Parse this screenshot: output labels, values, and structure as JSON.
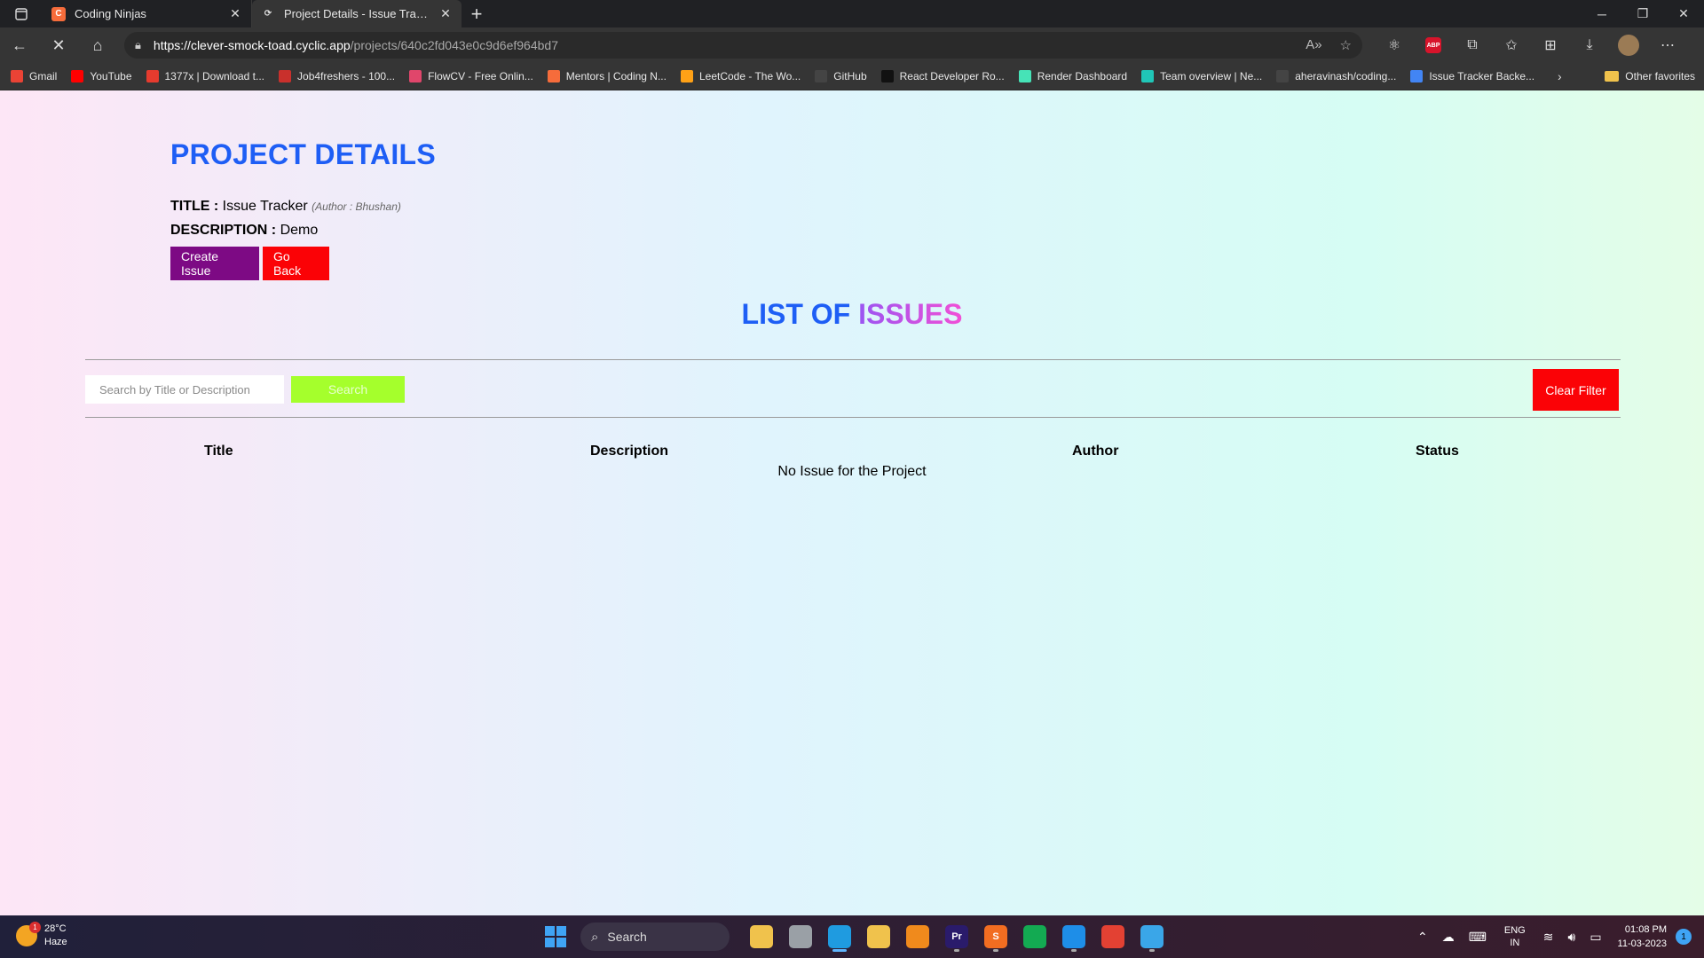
{
  "browser": {
    "tabs": [
      {
        "title": "Coding Ninjas",
        "favicon": "coding-ninjas-icon",
        "favicon_color": "#f66c3b"
      },
      {
        "title": "Project Details - Issue Tracker App",
        "favicon": "loading-icon",
        "favicon_color": "#353535"
      }
    ],
    "url": {
      "host": "https://clever-smock-toad.cyclic.app",
      "path": "/projects/640c2fd043e0c9d6ef964bd7"
    },
    "bookmarks": [
      {
        "label": "Gmail",
        "icon": "gmail-icon",
        "color": "#ea4335"
      },
      {
        "label": "YouTube",
        "icon": "youtube-icon",
        "color": "#ff0000"
      },
      {
        "label": "1377x | Download t...",
        "icon": "1377x-icon",
        "color": "#e63b2e"
      },
      {
        "label": "Job4freshers - 100...",
        "icon": "job4freshers-icon",
        "color": "#c9302c"
      },
      {
        "label": "FlowCV - Free Onlin...",
        "icon": "flowcv-icon",
        "color": "#e0466b"
      },
      {
        "label": "Mentors | Coding N...",
        "icon": "coding-ninjas-icon",
        "color": "#f66c3b"
      },
      {
        "label": "LeetCode - The Wo...",
        "icon": "leetcode-icon",
        "color": "#ffa116"
      },
      {
        "label": "GitHub",
        "icon": "github-icon",
        "color": "#444444"
      },
      {
        "label": "React Developer Ro...",
        "icon": "roadmap-icon",
        "color": "#111111"
      },
      {
        "label": "Render Dashboard",
        "icon": "render-icon",
        "color": "#46e3b7"
      },
      {
        "label": "Team overview | Ne...",
        "icon": "netlify-icon",
        "color": "#20c6b7"
      },
      {
        "label": "aheravinash/coding...",
        "icon": "github-icon",
        "color": "#444444"
      },
      {
        "label": "Issue Tracker Backe...",
        "icon": "docs-icon",
        "color": "#4285f4"
      }
    ],
    "other_favorites": "Other favorites"
  },
  "page": {
    "heading": "PROJECT DETAILS",
    "title_label": "TITLE :",
    "title_value": "Issue Tracker",
    "author_text": "(Author : Bhushan)",
    "description_label": "DESCRIPTION :",
    "description_value": "Demo",
    "create_button": "Create Issue",
    "back_button": "Go Back",
    "list_heading_part1": "LIST OF",
    "list_heading_part2": "ISSUES",
    "search_placeholder": "Search by Title or Description",
    "search_button": "Search",
    "clear_button": "Clear Filter",
    "columns": [
      "Title",
      "Description",
      "Author",
      "Status"
    ],
    "empty_message": "No Issue for the Project",
    "colors": {
      "heading_blue": "#1e5ef5",
      "create_purple": "#7d0a84",
      "danger_red": "#fb0206",
      "search_green": "#a5ff2c"
    }
  },
  "taskbar": {
    "weather_temp": "28°C",
    "weather_desc": "Haze",
    "weather_badge": "1",
    "search_label": "Search",
    "apps": [
      {
        "name": "file-explorer-icon",
        "label": "",
        "color": "#f0c24c"
      },
      {
        "name": "task-view-icon",
        "label": "",
        "color": "#9aa0a6"
      },
      {
        "name": "edge-icon",
        "label": "",
        "color": "#1f9be0"
      },
      {
        "name": "folder-icon",
        "label": "",
        "color": "#f0c24c"
      },
      {
        "name": "vlc-icon",
        "label": "",
        "color": "#f08a1c"
      },
      {
        "name": "premiere-icon",
        "label": "Pr",
        "color": "#2a1b6b"
      },
      {
        "name": "sublime-icon",
        "label": "S",
        "color": "#f26d21"
      },
      {
        "name": "mongodb-icon",
        "label": "",
        "color": "#13aa52"
      },
      {
        "name": "vscode-icon",
        "label": "",
        "color": "#1e8ee8"
      },
      {
        "name": "chrome-icon",
        "label": "",
        "color": "#e34133"
      },
      {
        "name": "edge-beta-icon",
        "label": "",
        "color": "#3aa6e8"
      }
    ],
    "lang_top": "ENG",
    "lang_bottom": "IN",
    "time": "01:08 PM",
    "date": "11-03-2023",
    "notification_count": "1"
  }
}
